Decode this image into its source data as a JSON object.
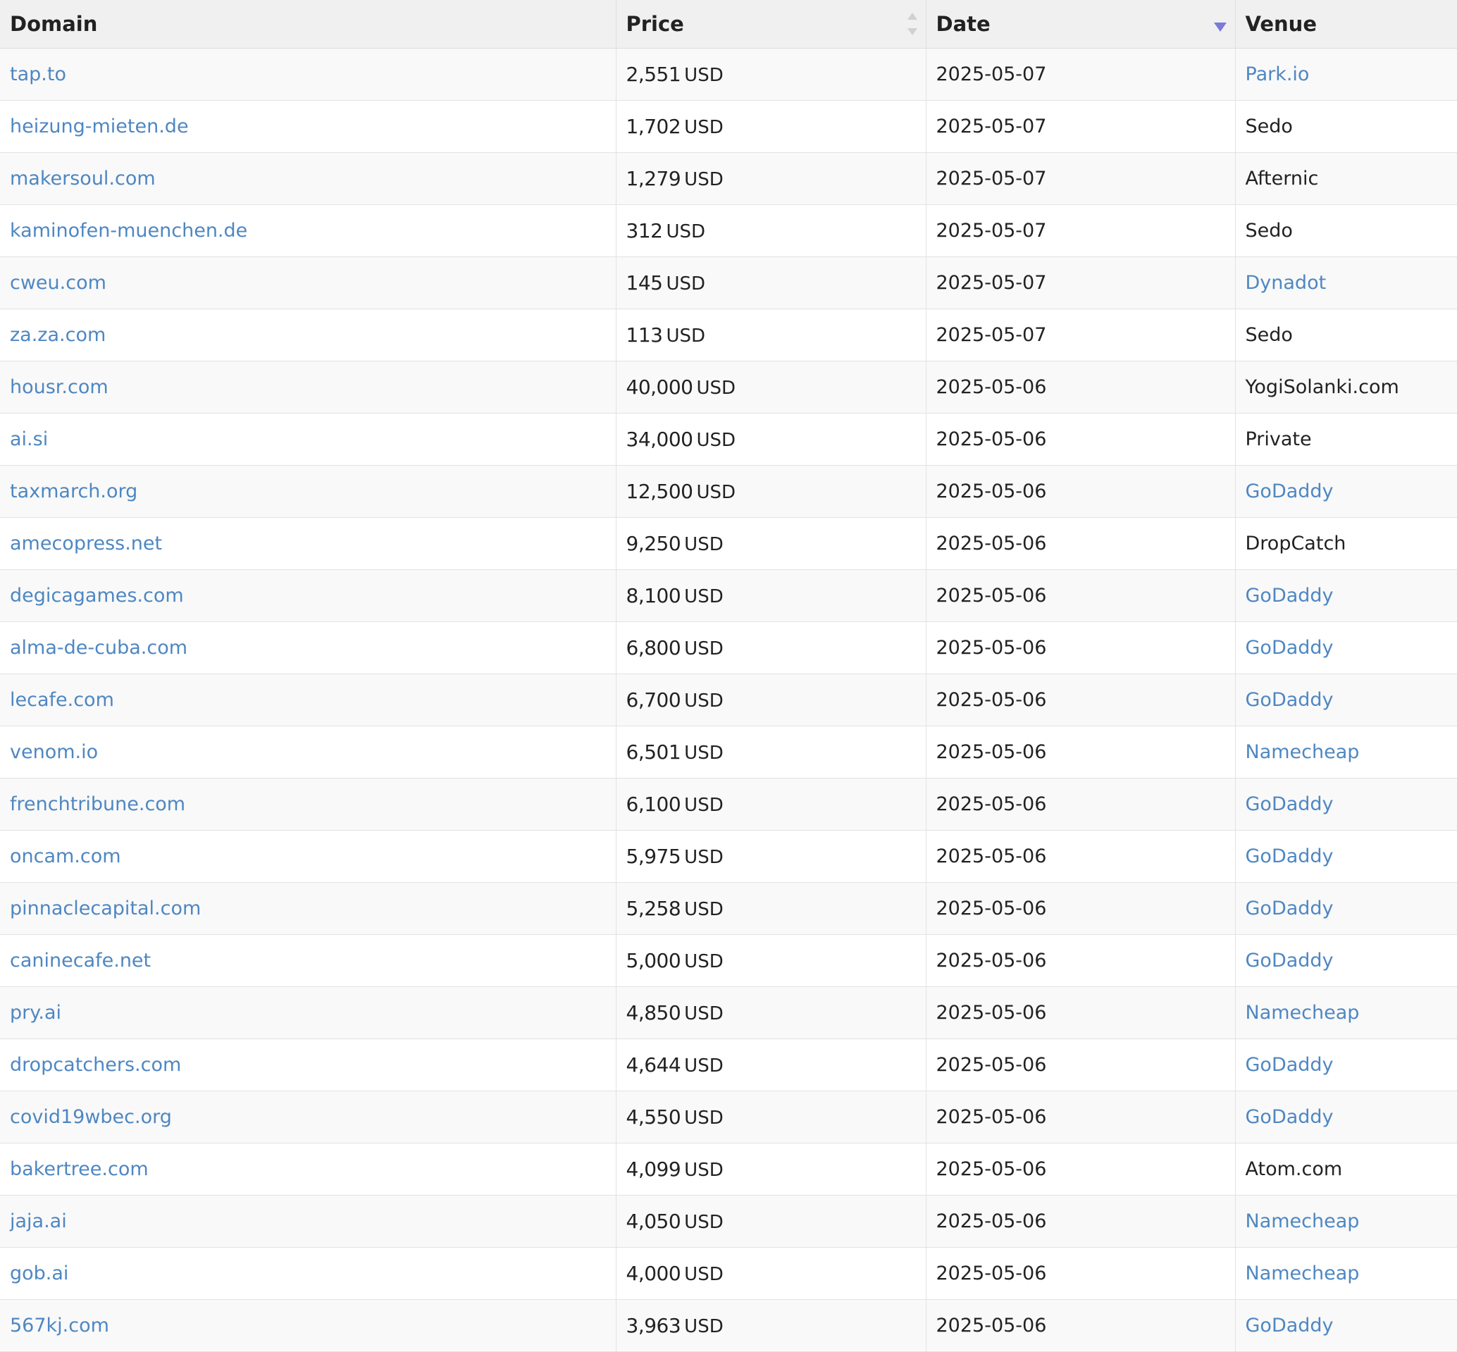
{
  "table": {
    "headers": {
      "domain": "Domain",
      "price": "Price",
      "date": "Date",
      "venue": "Venue"
    },
    "colors": {
      "link": "#4e87c2",
      "text": "#222222",
      "header_bg": "#f0f0f0",
      "sort_active": "#7a7ad8"
    },
    "sort": {
      "column": "date",
      "direction": "descending"
    },
    "rows": [
      {
        "domain": "tap.to",
        "price": "2,551",
        "currency": "USD",
        "date": "2025-05-07",
        "venue": "Park.io",
        "venue_link": true
      },
      {
        "domain": "heizung-mieten.de",
        "price": "1,702",
        "currency": "USD",
        "date": "2025-05-07",
        "venue": "Sedo",
        "venue_link": false
      },
      {
        "domain": "makersoul.com",
        "price": "1,279",
        "currency": "USD",
        "date": "2025-05-07",
        "venue": "Afternic",
        "venue_link": false
      },
      {
        "domain": "kaminofen-muenchen.de",
        "price": "312",
        "currency": "USD",
        "date": "2025-05-07",
        "venue": "Sedo",
        "venue_link": false
      },
      {
        "domain": "cweu.com",
        "price": "145",
        "currency": "USD",
        "date": "2025-05-07",
        "venue": "Dynadot",
        "venue_link": true
      },
      {
        "domain": "za.za.com",
        "price": "113",
        "currency": "USD",
        "date": "2025-05-07",
        "venue": "Sedo",
        "venue_link": false
      },
      {
        "domain": "housr.com",
        "price": "40,000",
        "currency": "USD",
        "date": "2025-05-06",
        "venue": "YogiSolanki.com",
        "venue_link": false
      },
      {
        "domain": "ai.si",
        "price": "34,000",
        "currency": "USD",
        "date": "2025-05-06",
        "venue": "Private",
        "venue_link": false
      },
      {
        "domain": "taxmarch.org",
        "price": "12,500",
        "currency": "USD",
        "date": "2025-05-06",
        "venue": "GoDaddy",
        "venue_link": true
      },
      {
        "domain": "amecopress.net",
        "price": "9,250",
        "currency": "USD",
        "date": "2025-05-06",
        "venue": "DropCatch",
        "venue_link": false
      },
      {
        "domain": "degicagames.com",
        "price": "8,100",
        "currency": "USD",
        "date": "2025-05-06",
        "venue": "GoDaddy",
        "venue_link": true
      },
      {
        "domain": "alma-de-cuba.com",
        "price": "6,800",
        "currency": "USD",
        "date": "2025-05-06",
        "venue": "GoDaddy",
        "venue_link": true
      },
      {
        "domain": "lecafe.com",
        "price": "6,700",
        "currency": "USD",
        "date": "2025-05-06",
        "venue": "GoDaddy",
        "venue_link": true
      },
      {
        "domain": "venom.io",
        "price": "6,501",
        "currency": "USD",
        "date": "2025-05-06",
        "venue": "Namecheap",
        "venue_link": true
      },
      {
        "domain": "frenchtribune.com",
        "price": "6,100",
        "currency": "USD",
        "date": "2025-05-06",
        "venue": "GoDaddy",
        "venue_link": true
      },
      {
        "domain": "oncam.com",
        "price": "5,975",
        "currency": "USD",
        "date": "2025-05-06",
        "venue": "GoDaddy",
        "venue_link": true
      },
      {
        "domain": "pinnaclecapital.com",
        "price": "5,258",
        "currency": "USD",
        "date": "2025-05-06",
        "venue": "GoDaddy",
        "venue_link": true
      },
      {
        "domain": "caninecafe.net",
        "price": "5,000",
        "currency": "USD",
        "date": "2025-05-06",
        "venue": "GoDaddy",
        "venue_link": true
      },
      {
        "domain": "pry.ai",
        "price": "4,850",
        "currency": "USD",
        "date": "2025-05-06",
        "venue": "Namecheap",
        "venue_link": true
      },
      {
        "domain": "dropcatchers.com",
        "price": "4,644",
        "currency": "USD",
        "date": "2025-05-06",
        "venue": "GoDaddy",
        "venue_link": true
      },
      {
        "domain": "covid19wbec.org",
        "price": "4,550",
        "currency": "USD",
        "date": "2025-05-06",
        "venue": "GoDaddy",
        "venue_link": true
      },
      {
        "domain": "bakertree.com",
        "price": "4,099",
        "currency": "USD",
        "date": "2025-05-06",
        "venue": "Atom.com",
        "venue_link": false
      },
      {
        "domain": "jaja.ai",
        "price": "4,050",
        "currency": "USD",
        "date": "2025-05-06",
        "venue": "Namecheap",
        "venue_link": true
      },
      {
        "domain": "gob.ai",
        "price": "4,000",
        "currency": "USD",
        "date": "2025-05-06",
        "venue": "Namecheap",
        "venue_link": true
      },
      {
        "domain": "567kj.com",
        "price": "3,963",
        "currency": "USD",
        "date": "2025-05-06",
        "venue": "GoDaddy",
        "venue_link": true
      }
    ]
  }
}
